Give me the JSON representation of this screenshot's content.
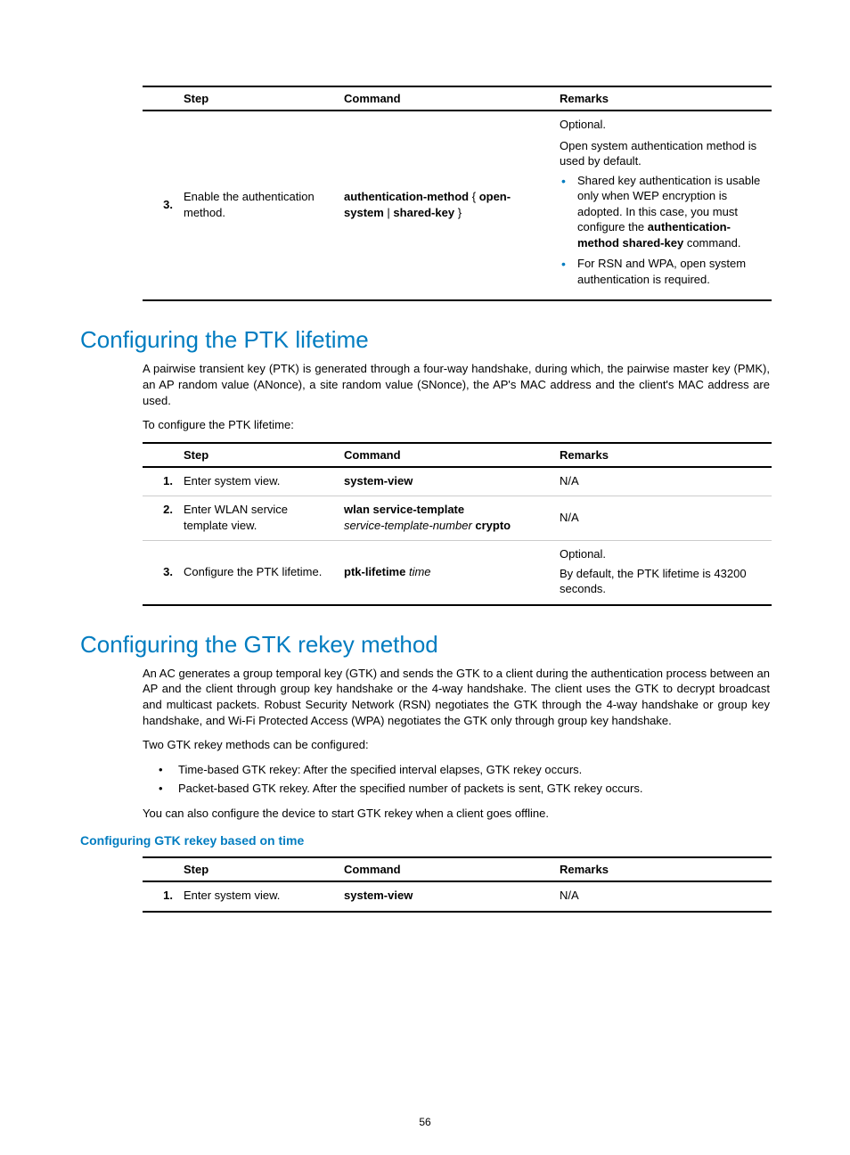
{
  "table1": {
    "headers": {
      "step": "Step",
      "command": "Command",
      "remarks": "Remarks"
    },
    "row": {
      "num": "3.",
      "step": "Enable the authentication method.",
      "cmd_b1": "authentication-method",
      "cmd_t1": " { ",
      "cmd_b2": "open-system",
      "cmd_t2": " | ",
      "cmd_b3": "shared-key",
      "cmd_t3": " }",
      "rem_p": "Optional.",
      "rem_p2": "Open system authentication method is used by default.",
      "rem_li1a": "Shared key authentication is usable only when WEP encryption is adopted. In this case, you must configure the ",
      "rem_li1b": "authentication-method shared-key",
      "rem_li1c": " command.",
      "rem_li2": "For RSN and WPA, open system authentication is required."
    }
  },
  "s1": {
    "title": "Configuring the PTK lifetime",
    "p1": "A pairwise transient key (PTK) is generated through a four-way handshake, during which, the pairwise master key (PMK), an AP random value (ANonce), a site random value (SNonce), the AP's MAC address and the client's MAC address are used.",
    "p2": "To configure the PTK lifetime:",
    "table": {
      "headers": {
        "step": "Step",
        "command": "Command",
        "remarks": "Remarks"
      },
      "rows": [
        {
          "num": "1.",
          "step": "Enter system view.",
          "cmd_b": "system-view",
          "remarks": "N/A"
        },
        {
          "num": "2.",
          "step": "Enter WLAN service template view.",
          "cmd_b": "wlan service-template",
          "cmd_i": "service-template-number",
          "cmd_b2": " crypto",
          "remarks": "N/A"
        },
        {
          "num": "3.",
          "step": "Configure the PTK lifetime.",
          "cmd_b": "ptk-lifetime",
          "cmd_i": " time",
          "rem_p": "Optional.",
          "rem_p2": "By default, the PTK lifetime is 43200 seconds."
        }
      ]
    }
  },
  "s2": {
    "title": "Configuring the GTK rekey method",
    "p1": "An AC generates a group temporal key (GTK) and sends the GTK to a client during the authentication process between an AP and the client through group key handshake or the 4-way handshake. The client uses the GTK to decrypt broadcast and multicast packets. Robust Security Network (RSN) negotiates the GTK through the 4-way handshake or group key handshake, and Wi-Fi Protected Access (WPA) negotiates the GTK only through group key handshake.",
    "p2": "Two GTK rekey methods can be configured:",
    "li1": "Time-based GTK rekey: After the specified interval elapses, GTK rekey occurs.",
    "li2": "Packet-based GTK rekey. After the specified number of packets is sent, GTK rekey occurs.",
    "p3": "You can also configure the device to start GTK rekey when a client goes offline.",
    "sub": "Configuring GTK rekey based on time",
    "table": {
      "headers": {
        "step": "Step",
        "command": "Command",
        "remarks": "Remarks"
      },
      "rows": [
        {
          "num": "1.",
          "step": "Enter system view.",
          "cmd_b": "system-view",
          "remarks": "N/A"
        }
      ]
    }
  },
  "page_number": "56"
}
